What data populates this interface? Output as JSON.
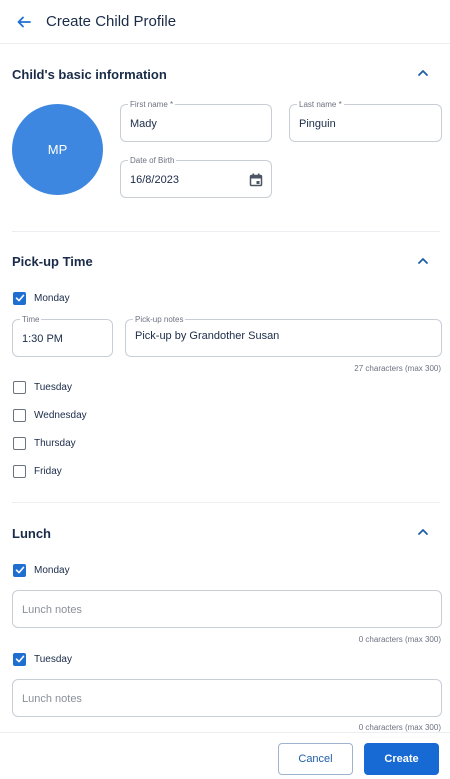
{
  "header": {
    "title": "Create Child Profile",
    "back_icon": "arrow-left-icon"
  },
  "accent_color": "#1769d4",
  "basic_info": {
    "title": "Child's basic information",
    "avatar_initials": "MP",
    "first_name": {
      "label": "First name *",
      "value": "Mady"
    },
    "last_name": {
      "label": "Last name *",
      "value": "Pinguin"
    },
    "dob": {
      "label": "Date of Birth",
      "value": "16/8/2023",
      "icon": "calendar-icon"
    }
  },
  "pickup": {
    "title": "Pick-up Time",
    "monday": {
      "label": "Monday",
      "checked": true
    },
    "time": {
      "label": "Time",
      "value": "1:30 PM"
    },
    "notes": {
      "label": "Pick-up notes",
      "value": "Pick-up by Grandother Susan",
      "counter": "27 characters (max 300)"
    },
    "days": [
      {
        "label": "Tuesday",
        "checked": false
      },
      {
        "label": "Wednesday",
        "checked": false
      },
      {
        "label": "Thursday",
        "checked": false
      },
      {
        "label": "Friday",
        "checked": false
      }
    ]
  },
  "lunch": {
    "title": "Lunch",
    "days": [
      {
        "label": "Monday",
        "checked": true,
        "notes_placeholder": "Lunch notes",
        "counter": "0 characters (max 300)"
      },
      {
        "label": "Tuesday",
        "checked": true,
        "notes_placeholder": "Lunch notes",
        "counter": "0 characters (max 300)"
      }
    ]
  },
  "footer": {
    "cancel_label": "Cancel",
    "create_label": "Create"
  }
}
